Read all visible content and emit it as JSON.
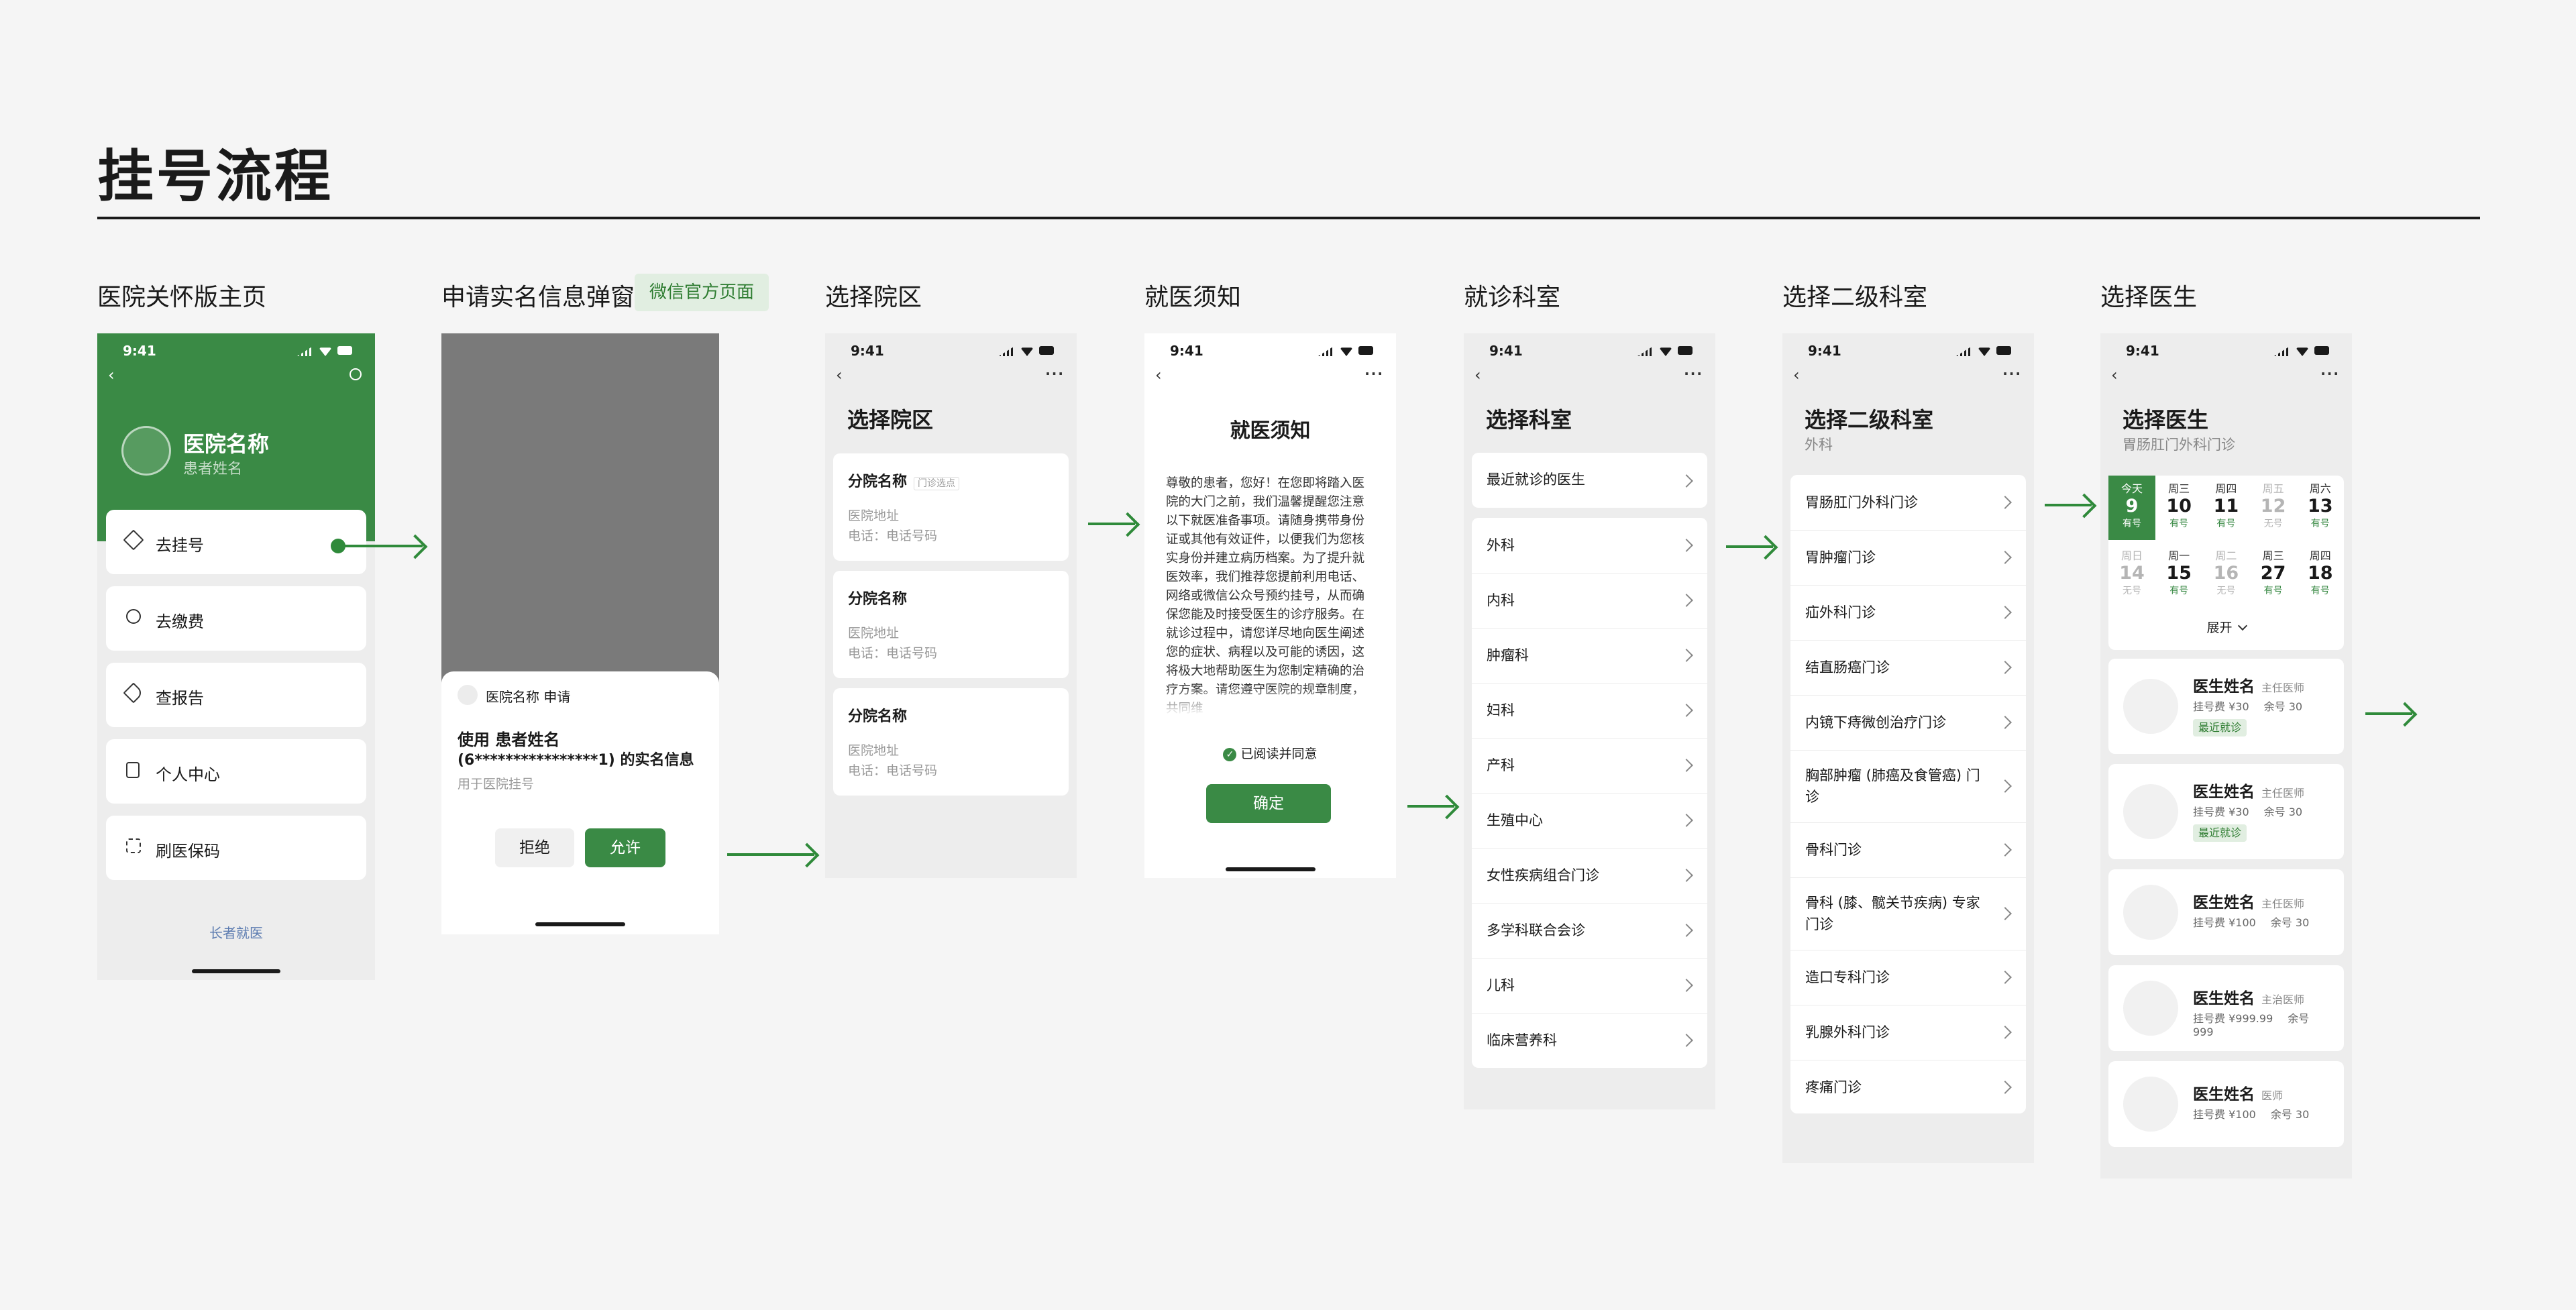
{
  "page": {
    "title": "挂号流程"
  },
  "sections": {
    "home": "医院关怀版主页",
    "auth": "申请实名信息弹窗",
    "auth_badge": "微信官方页面",
    "campus": "选择院区",
    "notice": "就医须知",
    "dept": "就诊科室",
    "subdept": "选择二级科室",
    "doctor": "选择医生"
  },
  "status_time": "9:41",
  "home": {
    "hospital_name": "医院名称",
    "patient_name": "患者姓名",
    "menu": [
      "去挂号",
      "去缴费",
      "查报告",
      "个人中心",
      "刷医保码"
    ],
    "footer_link": "长者就医"
  },
  "auth": {
    "app_name": "医院名称",
    "request": "申请",
    "line1": "使用 患者姓名",
    "line2": "(6****************1) 的实名信息",
    "purpose": "用于医院挂号",
    "reject": "拒绝",
    "allow": "允许"
  },
  "campus": {
    "title": "选择院区",
    "items": [
      {
        "name": "分院名称",
        "tag": "门诊选点",
        "address": "医院地址",
        "phone": "电话：电话号码"
      },
      {
        "name": "分院名称",
        "tag": "",
        "address": "医院地址",
        "phone": "电话：电话号码"
      },
      {
        "name": "分院名称",
        "tag": "",
        "address": "医院地址",
        "phone": "电话：电话号码"
      }
    ]
  },
  "notice": {
    "title": "就医须知",
    "body": "尊敬的患者，您好！在您即将踏入医院的大门之前，我们温馨提醒您注意以下就医准备事项。请随身携带身份证或其他有效证件，以便我们为您核实身份并建立病历档案。为了提升就医效率，我们推荐您提前利用电话、网络或微信公众号预约挂号，从而确保您能及时接受医生的诊疗服务。在就诊过程中，请您详尽地向医生阐述您的症状、病程以及可能的诱因，这将极大地帮助医生为您制定精确的治疗方案。请您遵守医院的规章制度，共同维",
    "agree": "已阅读并同意",
    "confirm": "确定"
  },
  "dept": {
    "title": "选择科室",
    "recent": "最近就诊的医生",
    "items": [
      "外科",
      "内科",
      "肿瘤科",
      "妇科",
      "产科",
      "生殖中心",
      "女性疾病组合门诊",
      "多学科联合会诊",
      "儿科",
      "临床营养科"
    ]
  },
  "subdept": {
    "title": "选择二级科室",
    "subtitle": "外科",
    "items": [
      "胃肠肛门外科门诊",
      "胃肿瘤门诊",
      "疝外科门诊",
      "结直肠癌门诊",
      "内镜下痔微创治疗门诊",
      "胸部肿瘤 (肺癌及食管癌) 门诊",
      "骨科门诊",
      "骨科 (膝、髋关节疾病) 专家门诊",
      "造口专科门诊",
      "乳腺外科门诊",
      "疼痛门诊"
    ]
  },
  "doctor": {
    "title": "选择医生",
    "subtitle": "胃肠肛门外科门诊",
    "week1": [
      {
        "w": "今天",
        "d": "9",
        "s": "有号",
        "state": "sel"
      },
      {
        "w": "周三",
        "d": "10",
        "s": "有号",
        "state": "on"
      },
      {
        "w": "周四",
        "d": "11",
        "s": "有号",
        "state": "on"
      },
      {
        "w": "周五",
        "d": "12",
        "s": "无号",
        "state": "off"
      },
      {
        "w": "周六",
        "d": "13",
        "s": "有号",
        "state": "on"
      }
    ],
    "week2": [
      {
        "w": "周日",
        "d": "14",
        "s": "无号",
        "state": "off"
      },
      {
        "w": "周一",
        "d": "15",
        "s": "有号",
        "state": "on"
      },
      {
        "w": "周二",
        "d": "16",
        "s": "无号",
        "state": "off"
      },
      {
        "w": "周三",
        "d": "27",
        "s": "有号",
        "state": "on"
      },
      {
        "w": "周四",
        "d": "18",
        "s": "有号",
        "state": "on"
      }
    ],
    "expand": "展开",
    "list": [
      {
        "name": "医生姓名",
        "title": "主任医师",
        "fee": "挂号费 ¥30",
        "left": "余号 30",
        "tag": "最近就诊"
      },
      {
        "name": "医生姓名",
        "title": "主任医师",
        "fee": "挂号费 ¥30",
        "left": "余号 30",
        "tag": "最近就诊"
      },
      {
        "name": "医生姓名",
        "title": "主任医师",
        "fee": "挂号费 ¥100",
        "left": "余号 30",
        "tag": ""
      },
      {
        "name": "医生姓名",
        "title": "主治医师",
        "fee": "挂号费 ¥999.99",
        "left": "余号 999",
        "tag": ""
      },
      {
        "name": "医生姓名",
        "title": "医师",
        "fee": "挂号费 ¥100",
        "left": "余号 30",
        "tag": ""
      }
    ]
  },
  "colors": {
    "accent": "#3a8a45",
    "bg": "#f5f5f5",
    "screen_bg": "#ededed"
  }
}
